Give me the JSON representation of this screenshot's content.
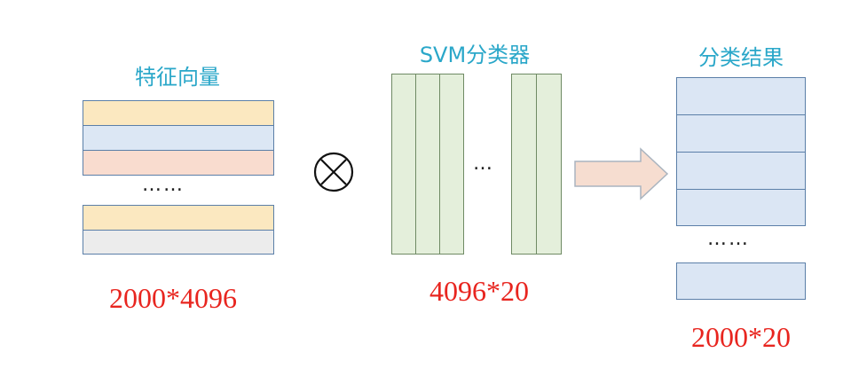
{
  "colors": {
    "title": "#2aa7c9",
    "dimension": "#e8251f",
    "row_yellow": "#fbe8c0",
    "row_blue": "#dce7f4",
    "row_salmon": "#f9dccf",
    "row_gray": "#ececec",
    "svm_column": "#e4efdb",
    "result_cell": "#dbe6f4",
    "arrow_fill": "#f6ddd0",
    "arrow_stroke": "#aab4bf"
  },
  "feature_vectors": {
    "title": "特征向量",
    "ellipsis": "……",
    "dimension": "2000*4096"
  },
  "operator": {
    "symbol": "⊗",
    "icon": "circled-times-icon"
  },
  "svm_classifier": {
    "title": "SVM分类器",
    "ellipsis": "…",
    "dimension": "4096*20"
  },
  "arrow": {
    "icon": "right-arrow-icon"
  },
  "classification_result": {
    "title": "分类结果",
    "ellipsis": "……",
    "dimension": "2000*20"
  }
}
